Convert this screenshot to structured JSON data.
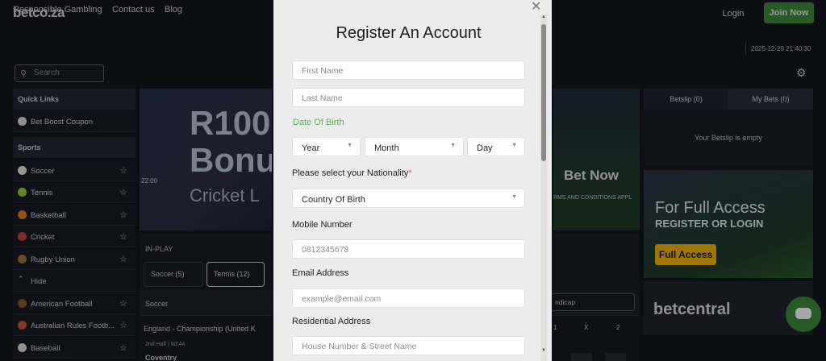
{
  "header": {
    "logo": "betco.za",
    "login": "Login",
    "join": "Join Now"
  },
  "nav": {
    "links": [
      "Responsible Gambling",
      "Contact us",
      "Blog"
    ],
    "clock": "2025-12-29 21:40:30"
  },
  "search": {
    "placeholder": "Search"
  },
  "sidebar": {
    "quick_links_title": "Quick Links",
    "quick_links": [
      "Bet Boost Coupon"
    ],
    "sports_title": "Sports",
    "sports": [
      {
        "label": "Soccer",
        "color": "#e8e8e8"
      },
      {
        "label": "Tennis",
        "color": "#9acd32"
      },
      {
        "label": "Basketball",
        "color": "#e07b2a"
      },
      {
        "label": "Cricket",
        "color": "#c94040"
      },
      {
        "label": "Rugby Union",
        "color": "#a0703c"
      },
      {
        "label": "Hide",
        "color": ""
      },
      {
        "label": "American Football",
        "color": "#8b5a2b"
      },
      {
        "label": "Australian Rules Footb...",
        "color": "#c05a3a"
      },
      {
        "label": "Baseball",
        "color": "#dddddd"
      }
    ]
  },
  "banner": {
    "line1": "R100",
    "line2": "Bonu",
    "line3": "Cricket L",
    "time": "22:00"
  },
  "inplay": {
    "title": "IN-PLAY",
    "pills": [
      "Soccer (5)",
      "Tennis (12)"
    ],
    "column": "Soccer",
    "match_title": "England - Championship (United K",
    "match_time": "2nd Half | 80:44",
    "team": "Coventry",
    "odds_headers": [
      "1",
      "X",
      "2"
    ],
    "handicap": "ndicap"
  },
  "banner2": {
    "cta": "Bet Now",
    "terms": "RMS AND CONDITIONS APPL"
  },
  "betslip": {
    "tabs": [
      "Betslip (0)",
      "My Bets (0)"
    ],
    "empty": "Your Betslip is empty"
  },
  "promo": {
    "line1": "For Full Access",
    "line2": "REGISTER OR LOGIN",
    "button": "Full Access",
    "brand": "betcentral"
  },
  "modal": {
    "title": "Register An Account",
    "first_name": "First Name",
    "last_name": "Last Name",
    "dob_label": "Date Of Birth",
    "year": "Year",
    "month": "Month",
    "day": "Day",
    "nationality_label": "Please select your Nationality",
    "country": "Country Of Birth",
    "mobile_label": "Mobile Number",
    "mobile_placeholder": "0812345678",
    "email_label": "Email Address",
    "email_placeholder": "example@email.com",
    "address_label": "Residential Address",
    "address_placeholder": "House Number & Street Name"
  }
}
